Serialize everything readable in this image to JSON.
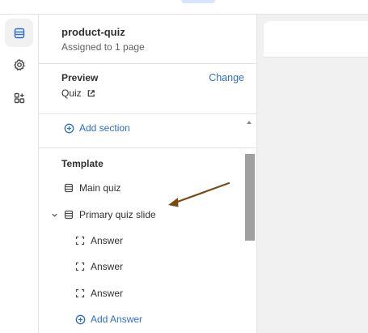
{
  "sidebar_rail": {
    "items": [
      {
        "icon": "sections-icon",
        "active": true
      },
      {
        "icon": "gear-icon",
        "active": false
      },
      {
        "icon": "apps-icon",
        "active": false
      }
    ]
  },
  "panel": {
    "title": "product-quiz",
    "subtitle": "Assigned to 1 page",
    "preview_label": "Preview",
    "change_label": "Change",
    "preview_value": "Quiz",
    "add_section_label": "Add section",
    "template_label": "Template",
    "main_quiz_label": "Main quiz",
    "slide_label": "Primary quiz slide",
    "answers": [
      {
        "label": "Answer"
      },
      {
        "label": "Answer"
      },
      {
        "label": "Answer"
      }
    ],
    "add_answer_label": "Add Answer"
  },
  "colors": {
    "link": "#2c6ecb",
    "annotation_arrow": "#7a4a12",
    "scrollbar": "#a0a0a0"
  }
}
